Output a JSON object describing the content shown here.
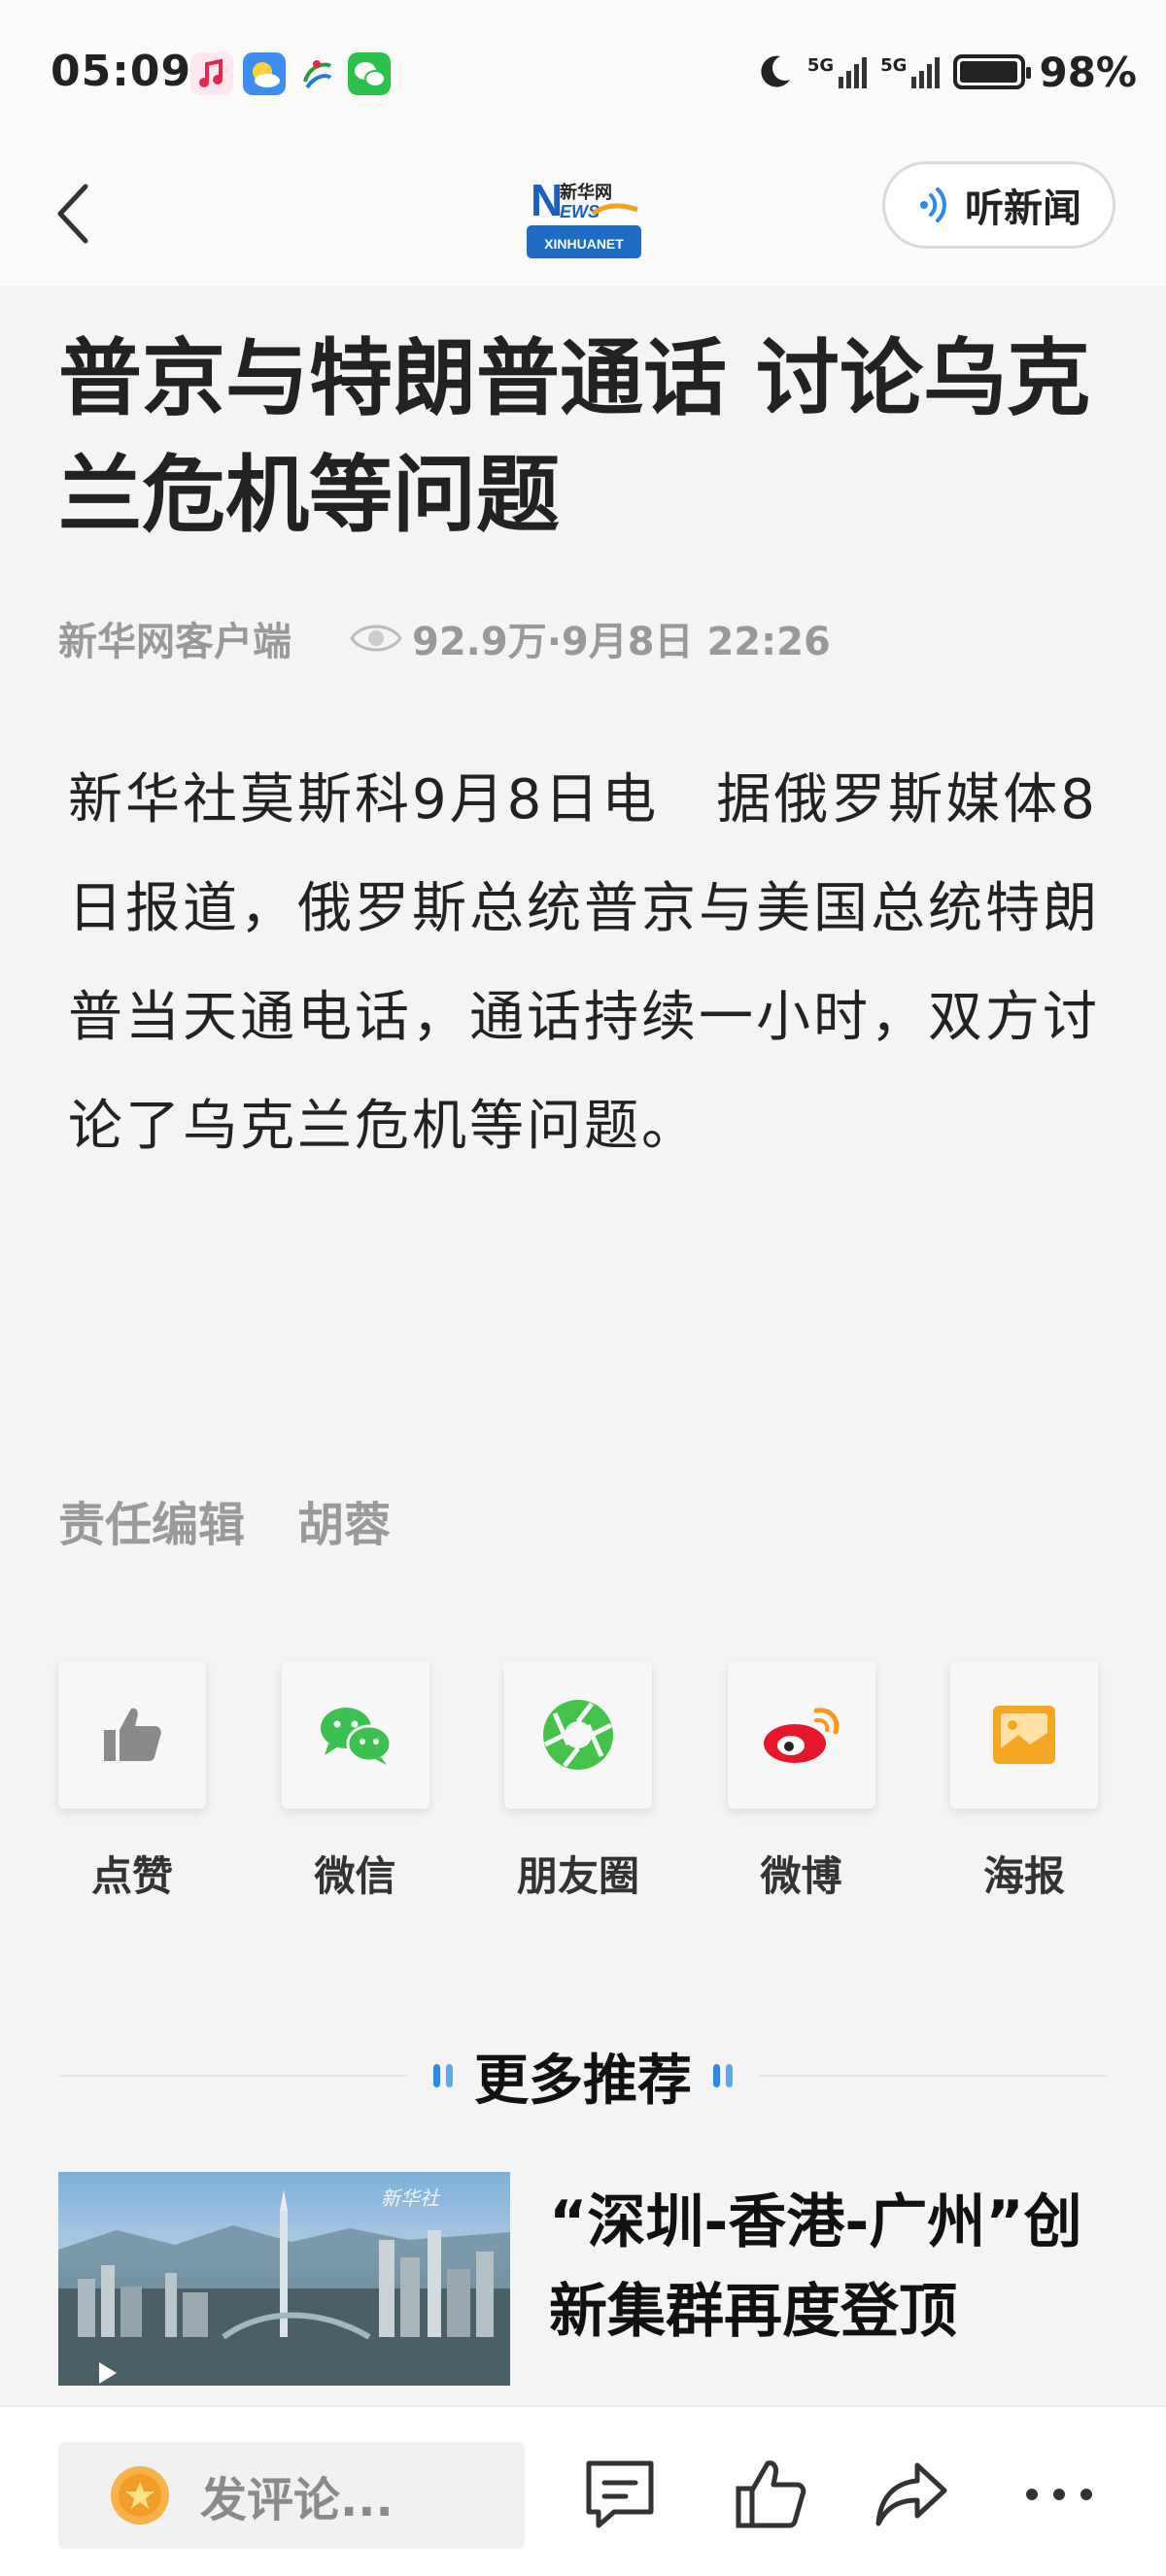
{
  "status_bar": {
    "time": "05:09",
    "network_1": "5G",
    "network_2": "5G",
    "battery": "98%",
    "battery_level": 0.98
  },
  "header": {
    "back_icon": "chevron-left-icon",
    "logo_text_top": "新华网",
    "logo_text_bottom": "XINHUANET",
    "logo_n": "N",
    "logo_ews": "EWS",
    "listen_label": "听新闻"
  },
  "article": {
    "title": "普京与特朗普通话 讨论乌克兰危机等问题",
    "source": "新华网客户端",
    "views_date": "92.9万·9月8日 22:26",
    "body": "新华社莫斯科9月8日电　据俄罗斯媒体8日报道，俄罗斯总统普京与美国总统特朗普当天通电话，通话持续一小时，双方讨论了乌克兰危机等问题。",
    "editor_label": "责任编辑",
    "editor_name": "胡蓉"
  },
  "share": [
    {
      "label": "点赞",
      "icon": "thumbs-up-icon",
      "color": "#8a8a8a"
    },
    {
      "label": "微信",
      "icon": "wechat-icon",
      "color": "#3cc051"
    },
    {
      "label": "朋友圈",
      "icon": "moments-icon",
      "color": "#45c24a"
    },
    {
      "label": "微博",
      "icon": "weibo-icon",
      "color": "#e6162d"
    },
    {
      "label": "海报",
      "icon": "poster-icon",
      "color": "#f5a623"
    }
  ],
  "recommend": {
    "heading": "更多推荐",
    "items": [
      {
        "title": "“深圳-香港-广州”创新集群再度登顶",
        "thumb_watermark": "新华社"
      }
    ]
  },
  "bottom_bar": {
    "comment_placeholder": "发评论...",
    "icons": [
      "comment-icon",
      "thumbs-up-icon",
      "share-icon",
      "more-icon"
    ]
  }
}
